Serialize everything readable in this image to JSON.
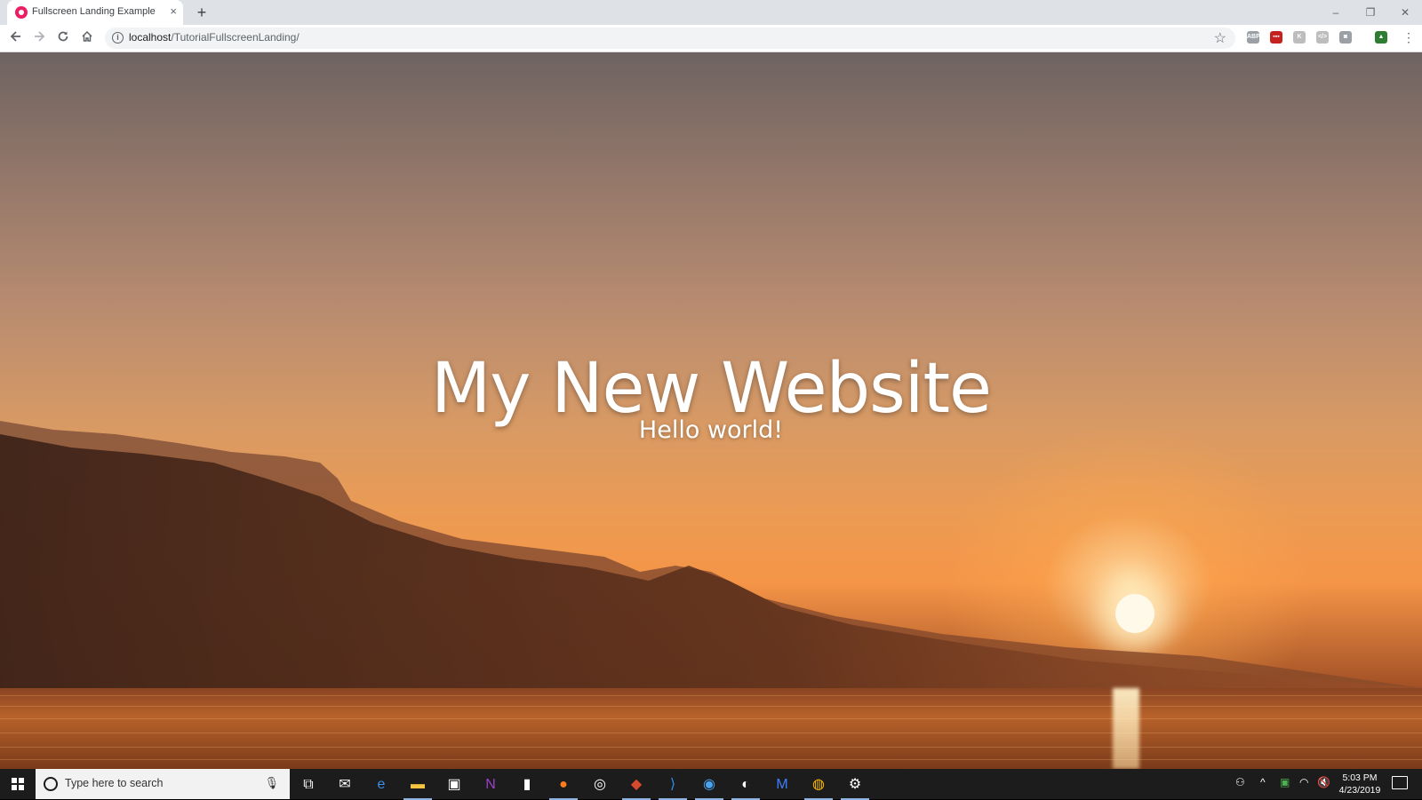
{
  "browser": {
    "tab_title": "Fullscreen Landing Example",
    "tab_close": "×",
    "new_tab": "+",
    "url_host": "localhost",
    "url_path": "/TutorialFullscreenLanding/",
    "window_controls": {
      "minimize": "–",
      "maximize": "❐",
      "close": "✕"
    },
    "extensions": [
      {
        "name": "abp-icon",
        "label": "ABP",
        "color": "#9aa0a6"
      },
      {
        "name": "ext-red-icon",
        "label": "▪▪▪",
        "color": "#c5221f"
      },
      {
        "name": "ext-gray-icon",
        "label": "K",
        "color": "#bdbdbd"
      },
      {
        "name": "ext-code-icon",
        "label": "</>",
        "color": "#bdbdbd"
      },
      {
        "name": "camera-icon",
        "label": "◙",
        "color": "#9aa0a6"
      },
      {
        "name": "ext-green-icon",
        "label": "▲",
        "color": "#2e7d32"
      }
    ]
  },
  "page": {
    "title": "My New Website",
    "subtitle": "Hello world!"
  },
  "taskbar": {
    "search_placeholder": "Type here to search",
    "apps": [
      {
        "name": "task-view-icon",
        "glyph": "⧉",
        "color": "#ffffff",
        "active": false
      },
      {
        "name": "mail-icon",
        "glyph": "✉",
        "color": "#ffffff",
        "active": false
      },
      {
        "name": "edge-icon",
        "glyph": "e",
        "color": "#3a8ee6",
        "active": false
      },
      {
        "name": "file-explorer-icon",
        "glyph": "▬",
        "color": "#f5c542",
        "active": true
      },
      {
        "name": "store-icon",
        "glyph": "▣",
        "color": "#ffffff",
        "active": false
      },
      {
        "name": "onenote-icon",
        "glyph": "N",
        "color": "#9b3fc8",
        "active": false
      },
      {
        "name": "twitch-icon",
        "glyph": "▮",
        "color": "#ffffff",
        "active": false
      },
      {
        "name": "firefox-icon",
        "glyph": "●",
        "color": "#ff7a1a",
        "active": true
      },
      {
        "name": "obs-icon",
        "glyph": "◎",
        "color": "#ffffff",
        "active": false
      },
      {
        "name": "app-icon",
        "glyph": "◆",
        "color": "#d84a2c",
        "active": true
      },
      {
        "name": "vscode-icon",
        "glyph": "⟩",
        "color": "#2b8fe3",
        "active": true
      },
      {
        "name": "chat-icon",
        "glyph": "◉",
        "color": "#4aa3f0",
        "active": true
      },
      {
        "name": "steam-icon",
        "glyph": "◐",
        "color": "#ffffff",
        "active": true
      },
      {
        "name": "malwarebytes-icon",
        "glyph": "M",
        "color": "#3d7eff",
        "active": false
      },
      {
        "name": "chrome-icon",
        "glyph": "◍",
        "color": "#fbbc05",
        "active": true
      },
      {
        "name": "settings-icon",
        "glyph": "⚙",
        "color": "#ffffff",
        "active": true
      }
    ],
    "time": "5:03 PM",
    "date": "4/23/2019"
  }
}
